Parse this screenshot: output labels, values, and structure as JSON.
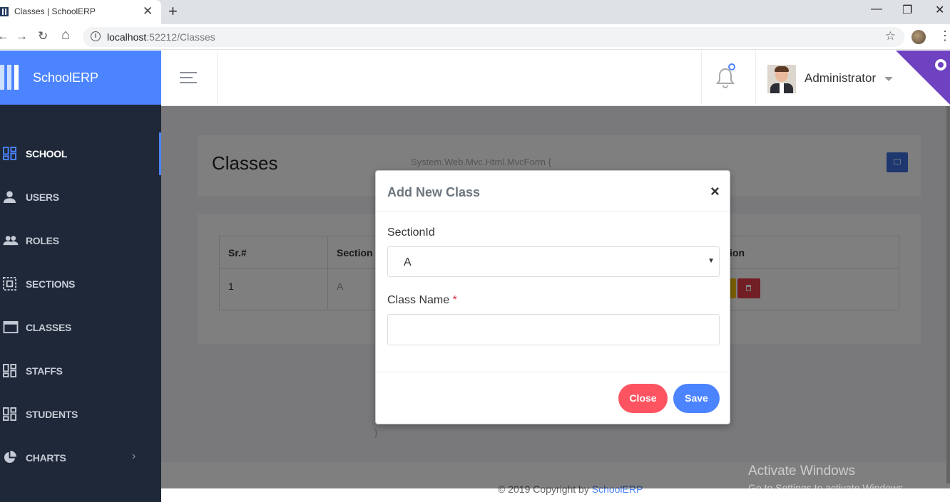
{
  "browser": {
    "tab_title": "Classes | SchoolERP",
    "tab_close": "✕",
    "new_tab": "+",
    "win_min": "—",
    "win_max": "❐",
    "win_close": "✕",
    "back": "←",
    "forward": "→",
    "reload": "↻",
    "home": "⌂",
    "url_host": "localhost",
    "url_rest": ":52212/Classes",
    "info": "i",
    "star": "☆",
    "menu": "⋮"
  },
  "brand": {
    "name": "SchoolERP"
  },
  "sidebar": {
    "items": [
      {
        "label": "SCHOOL",
        "icon": "dashboard-icon"
      },
      {
        "label": "USERS",
        "icon": "user-icon"
      },
      {
        "label": "ROLES",
        "icon": "group-icon"
      },
      {
        "label": "SECTIONS",
        "icon": "select-icon"
      },
      {
        "label": "CLASSES",
        "icon": "window-icon"
      },
      {
        "label": "STAFFS",
        "icon": "dashboard-icon"
      },
      {
        "label": "STUDENTS",
        "icon": "dashboard-icon"
      },
      {
        "label": "CHARTS",
        "icon": "pie-chart-icon"
      }
    ],
    "chevron": "›"
  },
  "header": {
    "user_name": "Administrator"
  },
  "page": {
    "title": "Classes",
    "mvc_text": "System.Web.Mvc.Html.MvcForm {",
    "closing_brace": "}",
    "table": {
      "headers": [
        "Sr.#",
        "Section",
        "ion"
      ],
      "rows": [
        {
          "sr": "1",
          "section": "A"
        }
      ]
    }
  },
  "footer": {
    "copyright_prefix": "© 2019 Copyright by ",
    "copyright_link": "SchoolERP"
  },
  "modal": {
    "title": "Add New Class",
    "close_x": "×",
    "section_label": "SectionId",
    "section_value": "A",
    "section_arrow": "▼",
    "class_label": "Class Name",
    "required_mark": "*",
    "class_value": "",
    "close_button": "Close",
    "save_button": "Save"
  },
  "watermark": {
    "title": "Activate Windows",
    "subtitle": "Go to Settings to activate Windows."
  },
  "colors": {
    "accent": "#4c84ff",
    "sidebar": "#1f2838",
    "danger": "#fe5461",
    "warning": "#f4c20d",
    "github_corner": "#6f42c1"
  }
}
